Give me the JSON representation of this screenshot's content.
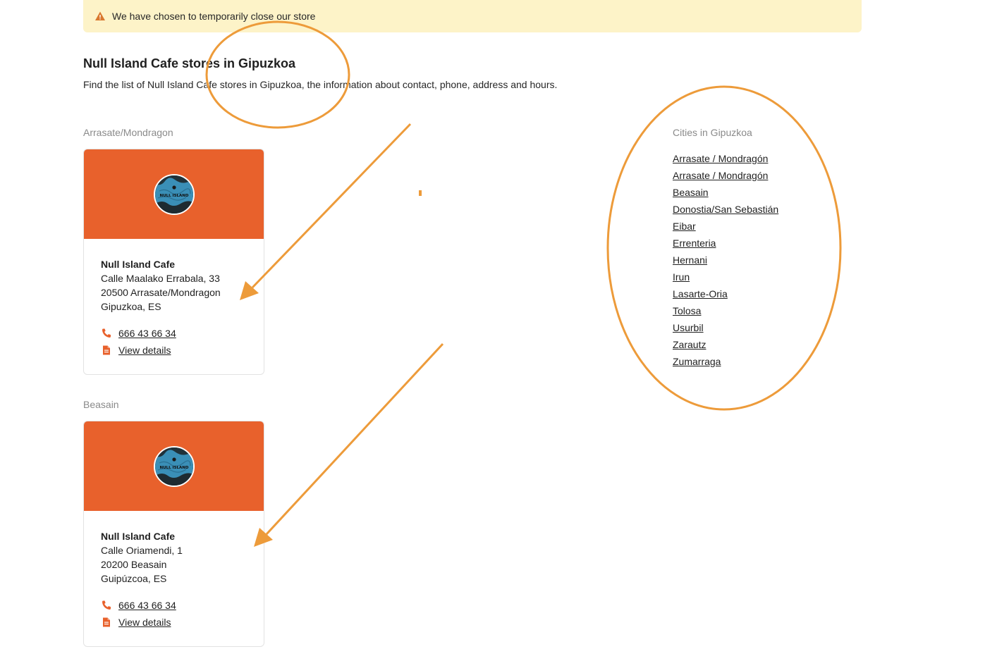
{
  "banner": {
    "message": "We have chosen to temporarily close our store"
  },
  "header": {
    "title": "Null Island Cafe stores in Gipuzkoa",
    "description": "Find the list of Null Island Cafe stores in Gipuzkoa, the information about contact, phone, address and hours."
  },
  "stores": [
    {
      "city": "Arrasate/Mondragon",
      "name": "Null Island Cafe",
      "address": "Calle Maalako Errabala, 33",
      "postal": "20500 Arrasate/Mondragon",
      "region": "Gipuzkoa, ES",
      "phone": "666 43 66 34",
      "details": "View details",
      "logo_text": "NULL ISLAND"
    },
    {
      "city": "Beasain",
      "name": "Null Island Cafe",
      "address": "Calle Oriamendi, 1",
      "postal": "20200 Beasain",
      "region": "Guipúzcoa, ES",
      "phone": "666 43 66 34",
      "details": "View details",
      "logo_text": "NULL ISLAND"
    }
  ],
  "cities": {
    "title": "Cities in Gipuzkoa",
    "items": [
      "Arrasate / Mondragón",
      "Arrasate / Mondragón",
      "Beasain",
      "Donostia/San Sebastián",
      "Eibar",
      "Errenteria",
      "Hernani",
      "Irun",
      "Lasarte-Oria",
      "Tolosa",
      "Usurbil",
      "Zarautz",
      "Zumarraga"
    ]
  },
  "icons": {
    "banner": "warning-icon",
    "phone": "phone-icon",
    "details": "document-icon"
  },
  "colors": {
    "banner_bg": "#fdf3c8",
    "brand_orange": "#e8612c",
    "annotation_orange": "#ed9b3a",
    "muted_text": "#8a8a8a"
  }
}
